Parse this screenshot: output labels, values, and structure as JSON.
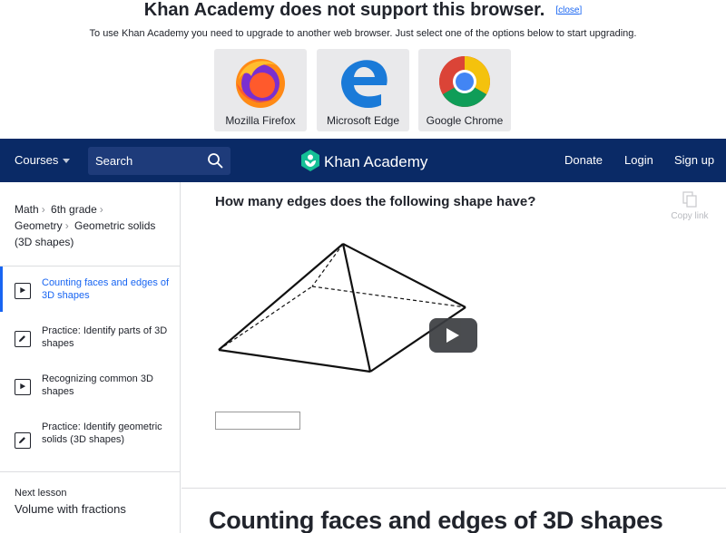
{
  "banner": {
    "title": "Khan Academy does not support this browser.",
    "close_label": "[close]",
    "subtitle": "To use Khan Academy you need to upgrade to another web browser. Just select one of the options below to start upgrading.",
    "browsers": [
      {
        "label": "Mozilla Firefox",
        "icon": "firefox-icon"
      },
      {
        "label": "Microsoft Edge",
        "icon": "edge-icon"
      },
      {
        "label": "Google Chrome",
        "icon": "chrome-icon"
      }
    ]
  },
  "navbar": {
    "courses_label": "Courses",
    "search_placeholder": "Search",
    "logo_text": "Khan Academy",
    "donate_label": "Donate",
    "login_label": "Login",
    "signup_label": "Sign up",
    "background_color": "#0a2a66"
  },
  "sidebar": {
    "breadcrumb": [
      "Math",
      "6th grade",
      "Geometry",
      "Geometric solids (3D shapes)"
    ],
    "lessons": [
      {
        "label": "Counting faces and edges of 3D shapes",
        "type": "video",
        "active": true
      },
      {
        "label": "Practice: Identify parts of 3D shapes",
        "type": "exercise",
        "active": false
      },
      {
        "label": "Recognizing common 3D shapes",
        "type": "video",
        "active": false
      },
      {
        "label": "Practice: Identify geometric solids (3D shapes)",
        "type": "exercise",
        "active": false
      }
    ],
    "next_lesson_caption": "Next lesson",
    "next_lesson_title": "Volume with fractions"
  },
  "main": {
    "question": "How many edges does the following shape have?",
    "copy_link_label": "Copy link",
    "answer_value": "",
    "lesson_title": "Counting faces and edges of 3D shapes"
  },
  "colors": {
    "accent": "#1865f2",
    "text": "#21242c",
    "tile": "#e9e9eb"
  }
}
